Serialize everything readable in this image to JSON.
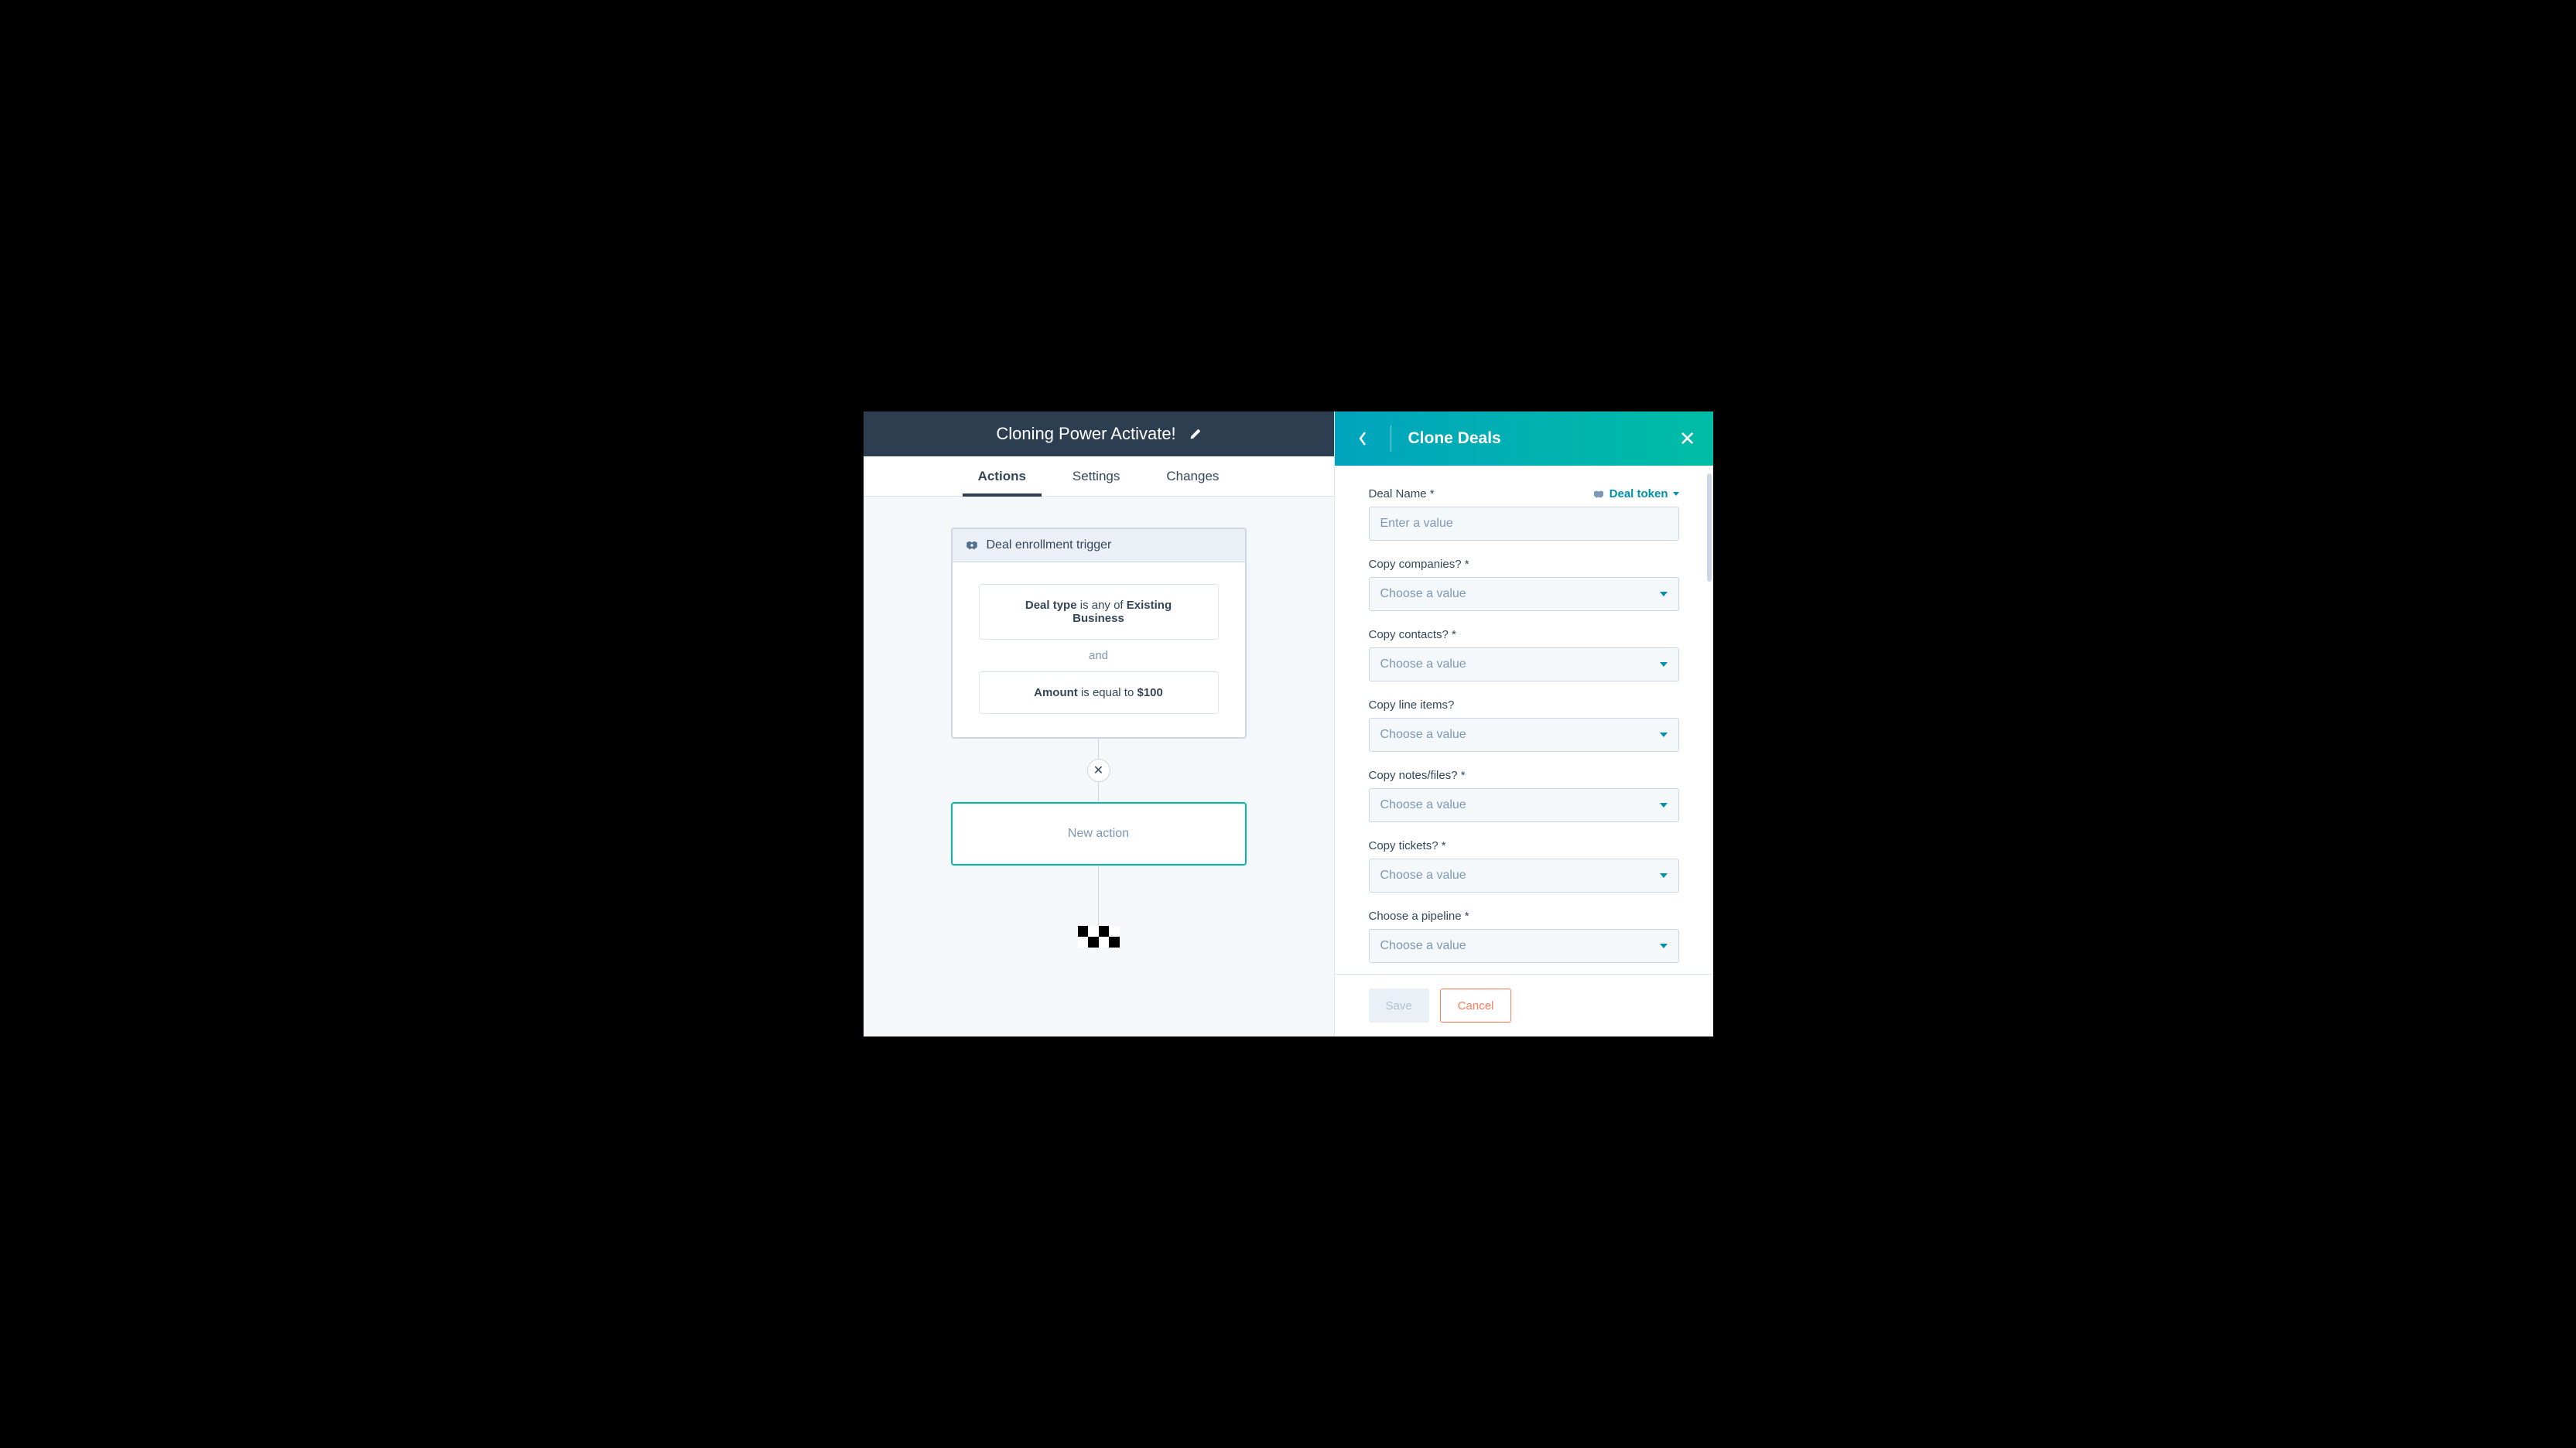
{
  "header": {
    "title": "Cloning Power Activate!"
  },
  "tabs": [
    "Actions",
    "Settings",
    "Changes"
  ],
  "active_tab": 0,
  "trigger": {
    "header": "Deal enrollment trigger",
    "filters": [
      {
        "field": "Deal type",
        "op": "is any of",
        "value": "Existing Business"
      },
      {
        "field": "Amount",
        "op": "is equal to",
        "value": "$100"
      }
    ],
    "join": "and"
  },
  "new_action_label": "New action",
  "panel": {
    "title": "Clone Deals",
    "token_link": "Deal token",
    "fields": [
      {
        "label": "Deal Name *",
        "type": "text",
        "placeholder": "Enter a value",
        "has_token": true
      },
      {
        "label": "Copy companies? *",
        "type": "select",
        "placeholder": "Choose a value"
      },
      {
        "label": "Copy contacts? *",
        "type": "select",
        "placeholder": "Choose a value"
      },
      {
        "label": "Copy line items?",
        "type": "select",
        "placeholder": "Choose a value"
      },
      {
        "label": "Copy notes/files? *",
        "type": "select",
        "placeholder": "Choose a value"
      },
      {
        "label": "Copy tickets? *",
        "type": "select",
        "placeholder": "Choose a value"
      },
      {
        "label": "Choose a pipeline *",
        "type": "select",
        "placeholder": "Choose a value"
      }
    ],
    "save_label": "Save",
    "cancel_label": "Cancel"
  }
}
